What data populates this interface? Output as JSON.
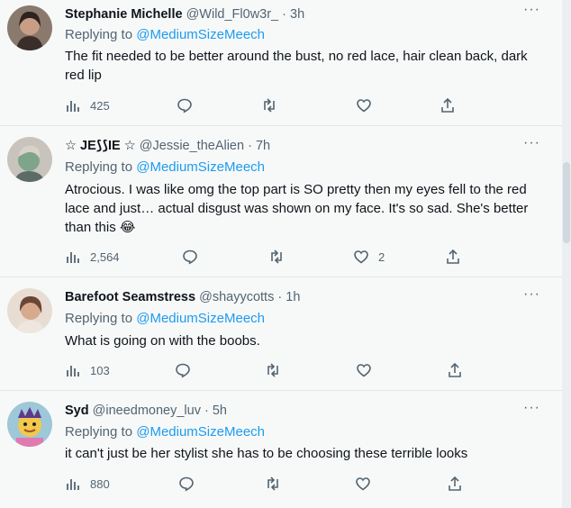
{
  "tweets": [
    {
      "name": "Stephanie Michelle",
      "handle": "@Wild_Fl0w3r_",
      "dot": "·",
      "time": "3h",
      "replying_prefix": "Replying to",
      "replying_to": "@MediumSizeMeech",
      "text": "The fit needed to be better around the bust, no red lace, hair clean back, dark red lip",
      "views": "425",
      "likes": ""
    },
    {
      "name": "☆ JE⟆⟆IE ☆",
      "handle": "@Jessie_theAlien",
      "dot": "·",
      "time": "7h",
      "replying_prefix": "Replying to",
      "replying_to": "@MediumSizeMeech",
      "text": "Atrocious. I was like omg the top part is SO pretty then my eyes fell to the red lace and just… actual disgust was shown on my face. It's so sad. She's better than this 😂",
      "views": "2,564",
      "likes": "2"
    },
    {
      "name": "Barefoot Seamstress",
      "handle": "@shayycotts",
      "dot": "·",
      "time": "1h",
      "replying_prefix": "Replying to",
      "replying_to": "@MediumSizeMeech",
      "text": "What is going on with the boobs.",
      "views": "103",
      "likes": ""
    },
    {
      "name": "Syd",
      "handle": "@ineedmoney_luv",
      "dot": "·",
      "time": "5h",
      "replying_prefix": "Replying to",
      "replying_to": "@MediumSizeMeech",
      "text": "it can't just be her stylist she has to be choosing these terrible looks",
      "views": "880",
      "likes": ""
    }
  ],
  "more_label": "···",
  "icons": [
    "views-icon",
    "reply-icon",
    "retweet-icon",
    "like-icon",
    "share-icon",
    "more-icon"
  ],
  "colors": {
    "link": "#1d9bf0",
    "muted": "#536471",
    "text": "#0f1419",
    "background": "#f7f9f9"
  }
}
